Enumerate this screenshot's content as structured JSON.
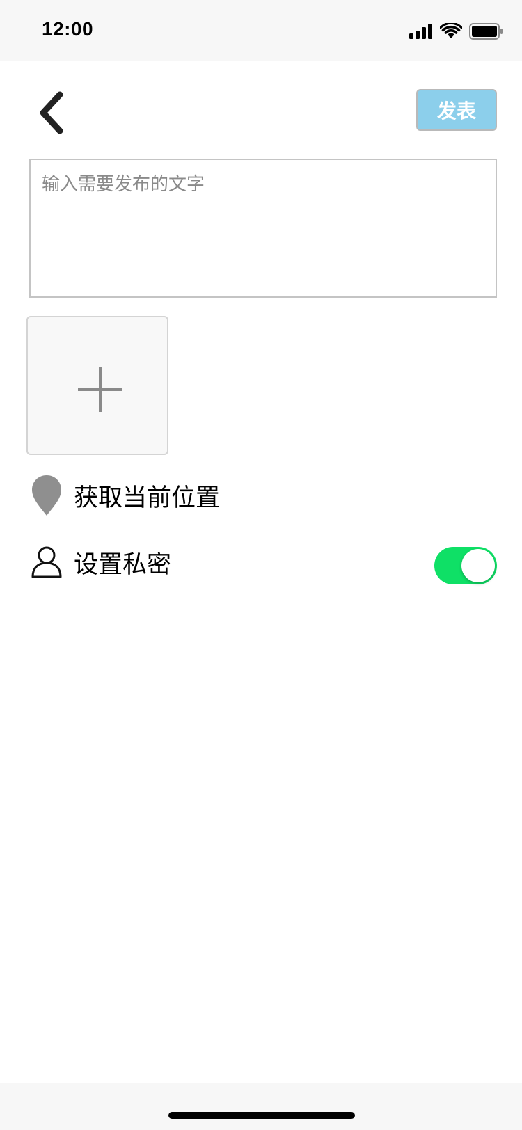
{
  "status_bar": {
    "time": "12:00",
    "icons": [
      "signal-icon",
      "wifi-icon",
      "battery-icon"
    ]
  },
  "header": {
    "back_icon": "chevron-left-icon",
    "publish_label": "发表"
  },
  "composer": {
    "placeholder": "输入需要发布的文字",
    "value": ""
  },
  "image_picker": {
    "icon": "plus-icon"
  },
  "location": {
    "icon": "map-pin-icon",
    "label": "获取当前位置"
  },
  "privacy": {
    "icon": "user-icon",
    "label": "设置私密",
    "enabled": true
  },
  "colors": {
    "publish_button": "#8ccfeb",
    "toggle_on": "#0fe066",
    "icon_gray": "#8a8a8a"
  }
}
